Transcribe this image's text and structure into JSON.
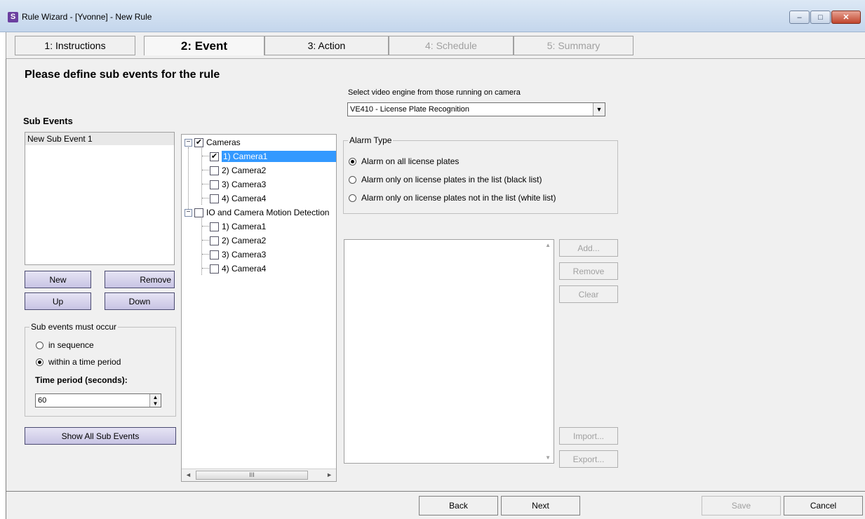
{
  "window": {
    "title": "Rule Wizard - [Yvonne] - New Rule",
    "app_icon_letter": "S"
  },
  "tabs": [
    {
      "label": "1: Instructions"
    },
    {
      "label": "2: Event"
    },
    {
      "label": "3: Action"
    },
    {
      "label": "4: Schedule"
    },
    {
      "label": "5: Summary"
    }
  ],
  "main": {
    "heading": "Please define sub events for the rule",
    "sub_events": {
      "label": "Sub Events",
      "items": [
        "New Sub Event 1"
      ],
      "new_label": "New",
      "remove_label": "Remove",
      "up_label": "Up",
      "down_label": "Down"
    },
    "occur_group": {
      "title": "Sub events must occur",
      "option_sequence": "in sequence",
      "option_period": "within a time period",
      "selected": "within a time period",
      "time_label": "Time period (seconds):",
      "time_value": "60"
    },
    "show_all_label": "Show All Sub Events",
    "tree": {
      "cameras_label": "Cameras",
      "cameras_checked": true,
      "cameras": [
        "1) Camera1",
        "2) Camera2",
        "3) Camera3",
        "4) Camera4"
      ],
      "camera_checked": [
        true,
        false,
        false,
        false
      ],
      "io_label": "IO and Camera Motion Detection",
      "io_checked": false,
      "io_cameras": [
        "1) Camera1",
        "2) Camera2",
        "3) Camera3",
        "4) Camera4"
      ],
      "scroll_thumb_glyph": "III"
    },
    "engine": {
      "label": "Select video engine from those running on camera",
      "selected": "VE410 - License Plate Recognition"
    },
    "alarm": {
      "title": "Alarm Type",
      "option_all": "Alarm on all license plates",
      "option_black": "Alarm only on license plates in the list (black list)",
      "option_white": "Alarm only on license plates not in the list (white list)",
      "selected": "Alarm on all license plates"
    },
    "plate_buttons": {
      "add": "Add...",
      "remove": "Remove",
      "clear": "Clear",
      "import": "Import...",
      "export": "Export..."
    }
  },
  "footer": {
    "back": "Back",
    "next": "Next",
    "save": "Save",
    "cancel": "Cancel"
  },
  "colors": {
    "selection": "#3399ff",
    "button_face": "#d6d3ec",
    "panel": "#f0f0f0"
  }
}
